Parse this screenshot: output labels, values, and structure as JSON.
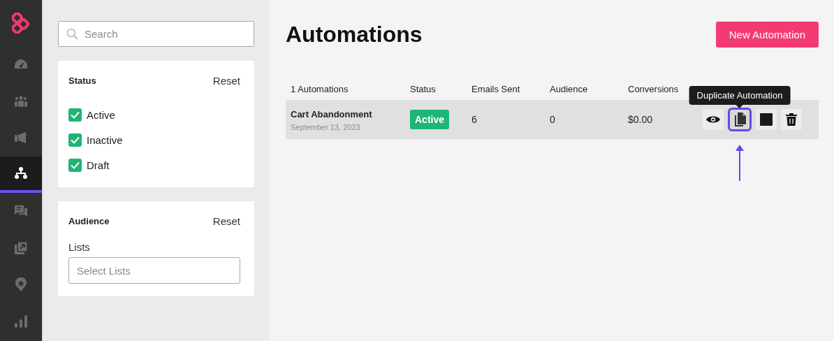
{
  "nav": {
    "items": [
      {
        "selected": false
      },
      {
        "selected": false
      },
      {
        "selected": false
      },
      {
        "selected": true
      },
      {
        "selected": false
      },
      {
        "selected": false
      },
      {
        "selected": false
      },
      {
        "selected": false
      }
    ]
  },
  "search": {
    "placeholder": "Search"
  },
  "filters": [
    {
      "kind": "checks",
      "title": "Status",
      "reset": "Reset",
      "options": [
        {
          "label": "Active",
          "checked": true
        },
        {
          "label": "Inactive",
          "checked": true
        },
        {
          "label": "Draft",
          "checked": true
        }
      ]
    },
    {
      "kind": "select",
      "title": "Audience",
      "reset": "Reset",
      "field_label": "Lists",
      "placeholder": "Select Lists"
    }
  ],
  "page_title": "Automations",
  "new_button": "New Automation",
  "table": {
    "columns": [
      "1 Automations",
      "Status",
      "Emails Sent",
      "Audience",
      "Conversions"
    ],
    "rows": [
      {
        "name": "Cart Abandonment",
        "date": "September 13, 2023",
        "status": "Active",
        "emails_sent": "6",
        "audience": "0",
        "conversions": "$0.00",
        "actions": [
          {
            "kind": "view",
            "highlighted": false
          },
          {
            "kind": "duplicate",
            "highlighted": true,
            "tooltip": "Duplicate Automation"
          },
          {
            "kind": "stop",
            "highlighted": false
          },
          {
            "kind": "delete",
            "highlighted": false
          }
        ]
      }
    ]
  }
}
